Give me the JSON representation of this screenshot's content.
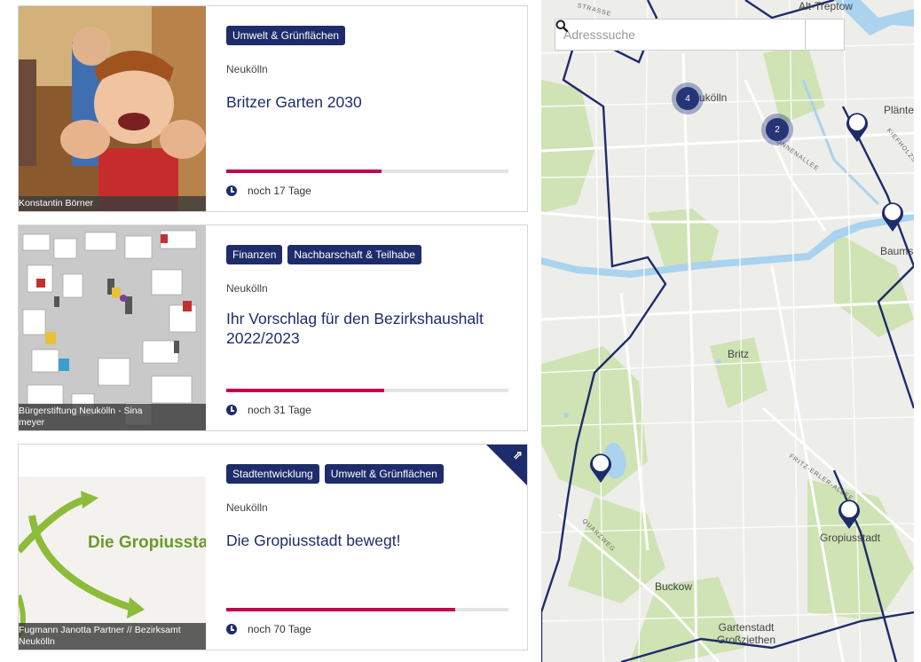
{
  "projects": [
    {
      "tags": [
        "Umwelt & Grünflächen"
      ],
      "district": "Neukölln",
      "title": "Britzer Garten 2030",
      "progress": 0.55,
      "remaining": "noch 17 Tage",
      "image_credit": "Konstantin Börner",
      "external": false
    },
    {
      "tags": [
        "Finanzen",
        "Nachbarschaft & Teilhabe"
      ],
      "district": "Neukölln",
      "title": "Ihr Vorschlag für den Bezirkshaushalt 2022/2023",
      "progress": 0.56,
      "remaining": "noch 31 Tage",
      "image_credit": "Bürgerstiftung Neukölln - Sina\nmeyer",
      "external": false
    },
    {
      "tags": [
        "Stadtentwicklung",
        "Umwelt & Grünflächen"
      ],
      "district": "Neukölln",
      "title": "Die Gropiusstadt bewegt!",
      "progress": 0.81,
      "remaining": "noch 70 Tage",
      "image_credit": "Fugmann Janotta Partner // Bezirksamt\nNeukölln",
      "image_text": "Die Gropiusstadt",
      "external": true
    }
  ],
  "map": {
    "search_placeholder": "Adresssuche",
    "search_icon": "magnifier-icon",
    "places": [
      "Alt-Treptow",
      "Neukölln",
      "Plänterwald",
      "Baumschulenweg",
      "Britz",
      "Gropiusstadt",
      "Buckow",
      "Gartenstadt Großziehen"
    ],
    "place_labels": {
      "alt_treptow": "Alt-Treptow",
      "neukolln": "ukölln",
      "plantewald": "Plänte",
      "baumschulenweg": "Baums",
      "britz": "Britz",
      "gropiusstadt": "Gropiusstadt",
      "buckow": "Buckow",
      "gartenstadt": "Gartenstadt\nGroßziethen"
    },
    "streets": {
      "strasse": "STRASSE",
      "sonnenallee": "SONNENALLEE",
      "kiefholzstr": "KIEFHOLZSTR",
      "fritz_erler": "FRITZ-ERLER-ALLEE",
      "quarzweg": "QUARZWEG"
    },
    "clusters": [
      {
        "count": "4"
      },
      {
        "count": "2"
      }
    ],
    "colors": {
      "district_border": "#1e2c6b",
      "water": "#a9d3ee",
      "park": "#cfe3b5",
      "cluster": "#263478"
    }
  }
}
